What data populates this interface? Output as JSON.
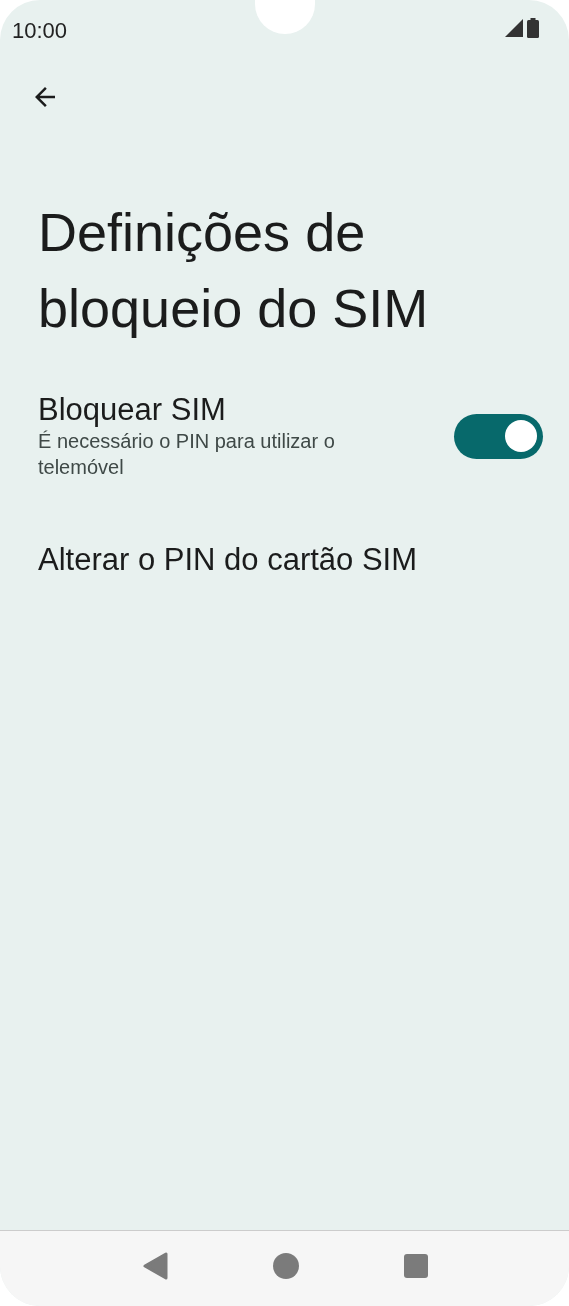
{
  "status_bar": {
    "time": "10:00"
  },
  "title": "Definições de bloqueio do SIM",
  "settings": [
    {
      "kind": "toggle",
      "title": "Bloquear SIM",
      "summary": "É necessário o PIN para utilizar o telemóvel",
      "on": true
    },
    {
      "kind": "item",
      "title": "Alterar o PIN do cartão SIM"
    }
  ]
}
